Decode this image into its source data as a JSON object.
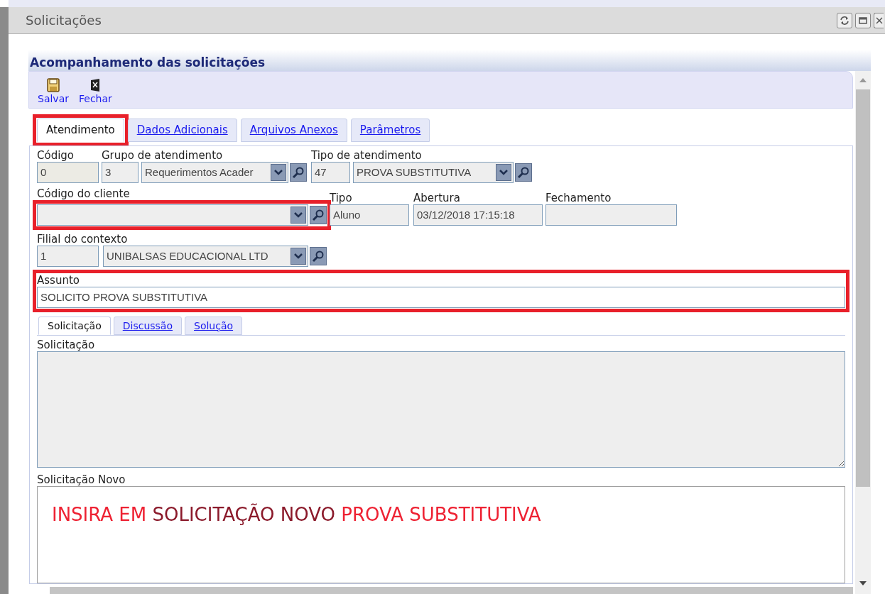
{
  "window": {
    "title": "Solicitações"
  },
  "heading": "Acompanhamento das solicitações",
  "toolbar": [
    {
      "kind": "save",
      "label": "Salvar"
    },
    {
      "kind": "close",
      "label": "Fechar"
    }
  ],
  "tabs": [
    {
      "label": "Atendimento",
      "selected": true,
      "highlighted": true
    },
    {
      "label": "Dados Adicionais",
      "selected": false,
      "highlighted": false
    },
    {
      "label": "Arquivos Anexos",
      "selected": false,
      "highlighted": false
    },
    {
      "label": "Parâmetros",
      "selected": false,
      "highlighted": false
    }
  ],
  "form": {
    "codigo": {
      "label": "Código",
      "value": "0"
    },
    "grupo": {
      "label": "Grupo de atendimento",
      "code": "3",
      "value": "Requerimentos Acader"
    },
    "tipo_atendimento": {
      "label": "Tipo de atendimento",
      "code": "47",
      "value": "PROVA SUBSTITUTIVA"
    },
    "cliente": {
      "label": "Código do cliente",
      "highlighted": true
    },
    "tipo": {
      "label": "Tipo",
      "value": "Aluno"
    },
    "abertura": {
      "label": "Abertura",
      "value": "03/12/2018 17:15:18"
    },
    "fechamento": {
      "label": "Fechamento"
    },
    "filial": {
      "label": "Filial do contexto",
      "code": "1",
      "value": "UNIBALSAS EDUCACIONAL LTD"
    },
    "assunto": {
      "label": "Assunto",
      "value": "SOLICITO PROVA SUBSTITUTIVA",
      "highlighted": true
    }
  },
  "subtabs": [
    {
      "label": "Solicitação",
      "selected": true
    },
    {
      "label": "Discussão",
      "selected": false
    },
    {
      "label": "Solução",
      "selected": false
    }
  ],
  "solicitacao": {
    "label": "Solicitação"
  },
  "solicitacao_novo": {
    "label": "Solicitação Novo",
    "segments": [
      {
        "text": "INSIRA EM ",
        "color": "#ee2233"
      },
      {
        "text": "SOLICITAÇÃO NOVO ",
        "color": "#8b1a2b"
      },
      {
        "text": "PROVA SUBSTITUTIVA",
        "color": "#ee2233"
      }
    ]
  }
}
